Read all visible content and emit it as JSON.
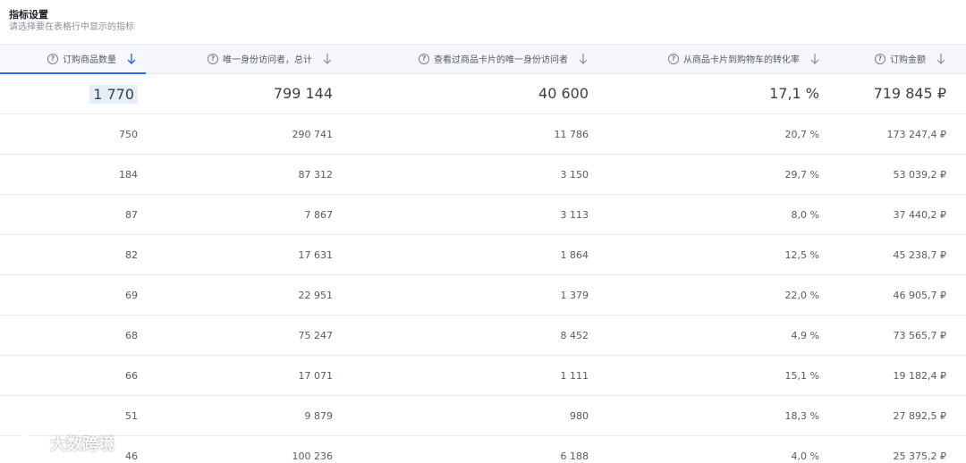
{
  "settings": {
    "title": "指标设置",
    "subtitle": "请选择要在表格行中显示的指标"
  },
  "columns": [
    {
      "label": "订购商品数量"
    },
    {
      "label": "唯一身份访问者，总计"
    },
    {
      "label": "查看过商品卡片的唯一身份访问者"
    },
    {
      "label": "从商品卡片到购物车的转化率"
    },
    {
      "label": "订购金额"
    }
  ],
  "totals": [
    "1 770",
    "799 144",
    "40 600",
    "17,1 %",
    "719 845 ₽"
  ],
  "rows": [
    [
      "750",
      "290 741",
      "11 786",
      "20,7 %",
      "173 247,4 ₽"
    ],
    [
      "184",
      "87 312",
      "3 150",
      "29,7 %",
      "53 039,2 ₽"
    ],
    [
      "87",
      "7 867",
      "3 113",
      "8,0 %",
      "37 440,2 ₽"
    ],
    [
      "82",
      "17 631",
      "1 864",
      "12,5 %",
      "45 238,7 ₽"
    ],
    [
      "69",
      "22 951",
      "1 379",
      "22,0 %",
      "46 905,7 ₽"
    ],
    [
      "68",
      "75 247",
      "8 452",
      "4,9 %",
      "73 565,7 ₽"
    ],
    [
      "66",
      "17 071",
      "1 111",
      "15,1 %",
      "19 182,4 ₽"
    ],
    [
      "51",
      "9 879",
      "980",
      "18,3 %",
      "27 892,5 ₽"
    ],
    [
      "46",
      "100 236",
      "6 188",
      "4,0 %",
      "25 375,2 ₽"
    ]
  ],
  "icons": {
    "help": "question-circle-icon",
    "sort": "arrow-down-icon"
  },
  "colors": {
    "accent": "#2b6bd8",
    "active_sort_arrow": "#2b6bd8",
    "inactive_sort_arrow": "#8a8f98"
  },
  "watermark": {
    "text": "大数跨境"
  }
}
